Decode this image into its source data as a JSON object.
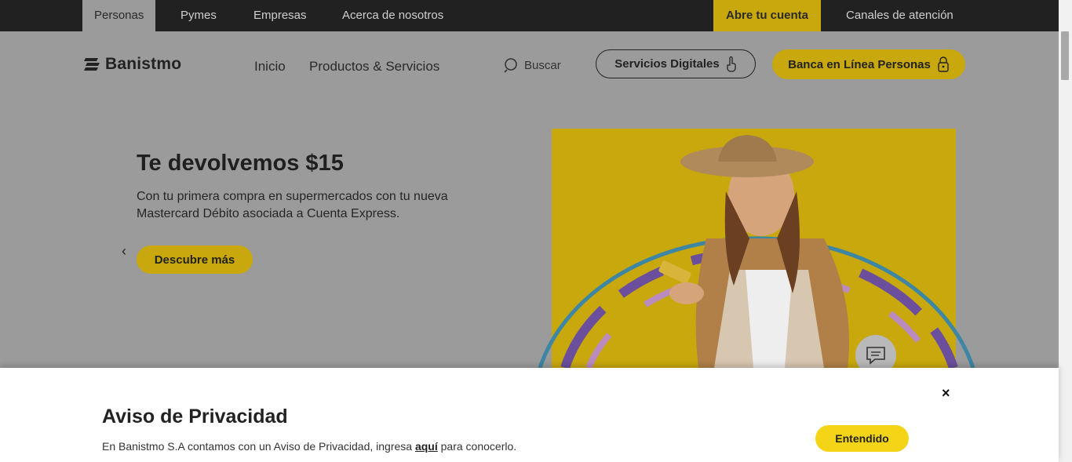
{
  "topnav": {
    "items": [
      "Personas",
      "Pymes",
      "Empresas",
      "Acerca de nosotros"
    ],
    "open_account": "Abre tu cuenta",
    "channels": "Canales de atención"
  },
  "header": {
    "logo": "Banistmo",
    "nav": [
      "Inicio",
      "Productos & Servicios"
    ],
    "search_label": "Buscar",
    "digital_services": "Servicios Digitales",
    "online_banking": "Banca en Línea Personas"
  },
  "hero": {
    "title": "Te devolvemos $15",
    "description": "Con tu primera compra en supermercados con tu nueva Mastercard Débito asociada a Cuenta Express.",
    "cta": "Descubre más"
  },
  "privacy": {
    "title": "Aviso de Privacidad",
    "text_before": "En Banistmo S.A contamos con un Aviso de Privacidad, ingresa ",
    "link": "aquí",
    "text_after": " para conocerlo.",
    "accept": "Entendido",
    "close": "×"
  },
  "colors": {
    "brand_yellow": "#f4d417",
    "dark": "#212121"
  },
  "icons": [
    "search-icon",
    "hand-pointer-icon",
    "lock-icon",
    "chevron-left-icon",
    "chevron-right-icon",
    "chat-icon",
    "close-icon",
    "banistmo-logo-icon"
  ]
}
